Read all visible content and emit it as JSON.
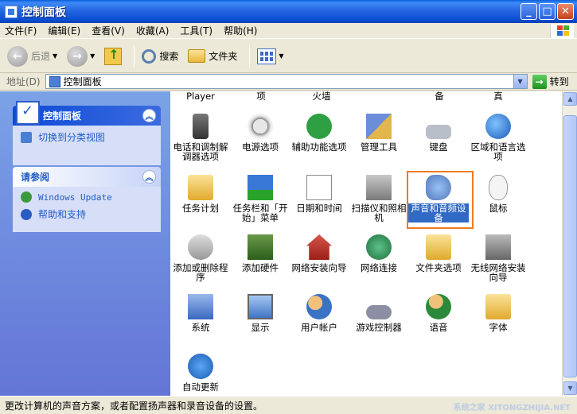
{
  "window": {
    "title": "控制面板"
  },
  "menu": [
    "文件(F)",
    "编辑(E)",
    "查看(V)",
    "收藏(A)",
    "工具(T)",
    "帮助(H)"
  ],
  "toolbar": {
    "back": "后退",
    "search": "搜索",
    "folders": "文件夹"
  },
  "address": {
    "label": "地址(D)",
    "value": "控制面板",
    "go": "转到"
  },
  "left_pane": {
    "panel1": {
      "title": "控制面板",
      "link": "切换到分类视图"
    },
    "panel2": {
      "title": "请参阅",
      "links": [
        "Windows Update",
        "帮助和支持"
      ]
    }
  },
  "partial_row": [
    "Player",
    "项",
    "火墙",
    "备",
    "真"
  ],
  "items": [
    "电话和调制解调器选项",
    "电源选项",
    "辅助功能选项",
    "管理工具",
    "键盘",
    "区域和语言选项",
    "任务计划",
    "任务栏和「开始」菜单",
    "日期和时间",
    "扫描仪和照相机",
    "声音和音频设备",
    "鼠标",
    "添加或删除程序",
    "添加硬件",
    "网络安装向导",
    "网络连接",
    "文件夹选项",
    "无线网络安装向导",
    "系统",
    "显示",
    "用户帐户",
    "游戏控制器",
    "语音",
    "字体",
    "自动更新"
  ],
  "selected_item": "声音和音频设备",
  "status": "更改计算机的声音方案，或者配置扬声器和录音设备的设置。",
  "watermark": "系统之家 XITONGZHIJIA.NET",
  "colors": {
    "accent": "#316AC5",
    "highlight_border": "#F07A22",
    "left_pane": "#6375D6"
  }
}
